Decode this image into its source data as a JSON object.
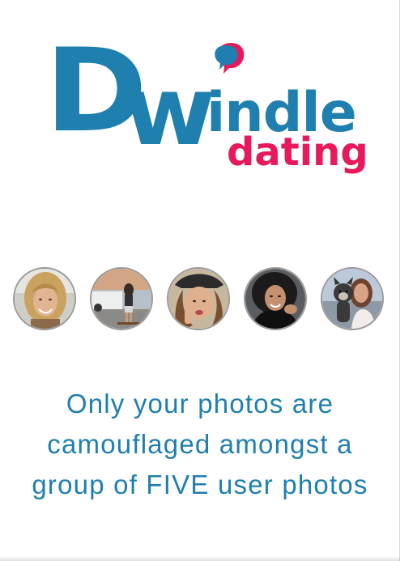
{
  "logo": {
    "primary": "Dwindle",
    "primary_d": "D",
    "primary_w": "w",
    "primary_rest": "indle",
    "secondary": "dating",
    "primary_color": "#1f7fae",
    "secondary_color": "#e8195a"
  },
  "avatars": [
    {
      "icon": "user-photo-1"
    },
    {
      "icon": "user-photo-2"
    },
    {
      "icon": "user-photo-3"
    },
    {
      "icon": "user-photo-4"
    },
    {
      "icon": "user-photo-5"
    }
  ],
  "caption": {
    "line1": "Only your photos are",
    "line2": "camouflaged amongst a",
    "line3": "group of FIVE user photos",
    "color": "#1f7fae"
  }
}
